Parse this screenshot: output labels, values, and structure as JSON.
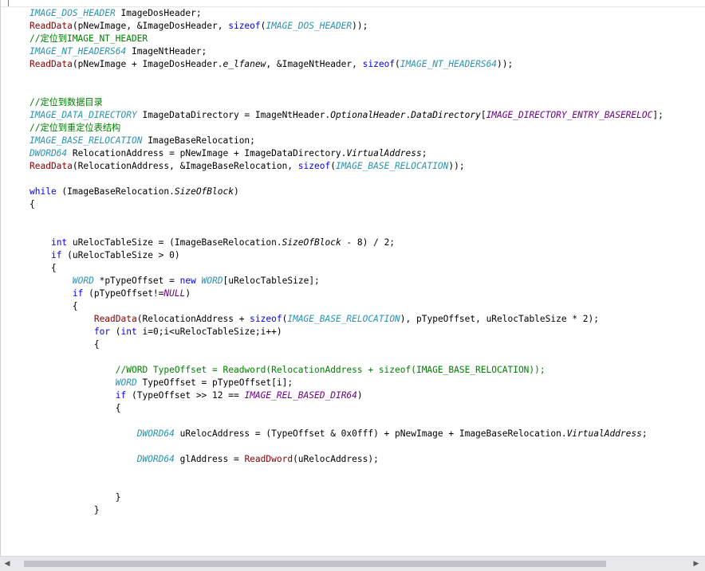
{
  "editor": {
    "lines": [
      {
        "segs": [
          {
            "c": "ty",
            "t": "IMAGE_DOS_HEADER"
          },
          {
            "c": "nm",
            "t": " ImageDosHeader;"
          }
        ]
      },
      {
        "segs": [
          {
            "c": "fn",
            "t": "ReadData"
          },
          {
            "c": "nm",
            "t": "(pNewImage, &ImageDosHeader, "
          },
          {
            "c": "kw",
            "t": "sizeof"
          },
          {
            "c": "nm",
            "t": "("
          },
          {
            "c": "ty",
            "t": "IMAGE_DOS_HEADER"
          },
          {
            "c": "nm",
            "t": "));"
          }
        ]
      },
      {
        "segs": [
          {
            "c": "cm",
            "t": "//定位到IMAGE_NT_HEADER"
          }
        ]
      },
      {
        "segs": [
          {
            "c": "ty",
            "t": "IMAGE_NT_HEADERS64"
          },
          {
            "c": "nm",
            "t": " ImageNtHeader;"
          }
        ]
      },
      {
        "segs": [
          {
            "c": "fn",
            "t": "ReadData"
          },
          {
            "c": "nm",
            "t": "(pNewImage + ImageDosHeader."
          },
          {
            "c": "mem",
            "t": "e_lfanew"
          },
          {
            "c": "nm",
            "t": ", &ImageNtHeader, "
          },
          {
            "c": "kw",
            "t": "sizeof"
          },
          {
            "c": "nm",
            "t": "("
          },
          {
            "c": "ty",
            "t": "IMAGE_NT_HEADERS64"
          },
          {
            "c": "nm",
            "t": "));"
          }
        ]
      },
      {
        "segs": []
      },
      {
        "segs": []
      },
      {
        "segs": [
          {
            "c": "cm",
            "t": "//定位到数据目录"
          }
        ]
      },
      {
        "segs": [
          {
            "c": "ty",
            "t": "IMAGE_DATA_DIRECTORY"
          },
          {
            "c": "nm",
            "t": " ImageDataDirectory = ImageNtHeader."
          },
          {
            "c": "mem",
            "t": "OptionalHeader"
          },
          {
            "c": "nm",
            "t": "."
          },
          {
            "c": "mem",
            "t": "DataDirectory"
          },
          {
            "c": "nm",
            "t": "["
          },
          {
            "c": "mac",
            "t": "IMAGE_DIRECTORY_ENTRY_BASERELOC"
          },
          {
            "c": "nm",
            "t": "];"
          }
        ]
      },
      {
        "segs": [
          {
            "c": "cm",
            "t": "//定位到重定位表结构"
          }
        ]
      },
      {
        "segs": [
          {
            "c": "ty",
            "t": "IMAGE_BASE_RELOCATION"
          },
          {
            "c": "nm",
            "t": " ImageBaseRelocation;"
          }
        ]
      },
      {
        "segs": [
          {
            "c": "ty",
            "t": "DWORD64"
          },
          {
            "c": "nm",
            "t": " RelocationAddress = pNewImage + ImageDataDirectory."
          },
          {
            "c": "mem",
            "t": "VirtualAddress"
          },
          {
            "c": "nm",
            "t": ";"
          }
        ]
      },
      {
        "segs": [
          {
            "c": "fn",
            "t": "ReadData"
          },
          {
            "c": "nm",
            "t": "(RelocationAddress, &ImageBaseRelocation, "
          },
          {
            "c": "kw",
            "t": "sizeof"
          },
          {
            "c": "nm",
            "t": "("
          },
          {
            "c": "ty",
            "t": "IMAGE_BASE_RELOCATION"
          },
          {
            "c": "nm",
            "t": "));"
          }
        ]
      },
      {
        "segs": []
      },
      {
        "segs": [
          {
            "c": "kw",
            "t": "while"
          },
          {
            "c": "nm",
            "t": " (ImageBaseRelocation."
          },
          {
            "c": "mem",
            "t": "SizeOfBlock"
          },
          {
            "c": "nm",
            "t": ")"
          }
        ]
      },
      {
        "segs": [
          {
            "c": "nm",
            "t": "{"
          }
        ]
      },
      {
        "segs": []
      },
      {
        "segs": []
      },
      {
        "segs": [
          {
            "c": "nm",
            "t": "    "
          },
          {
            "c": "kw",
            "t": "int"
          },
          {
            "c": "nm",
            "t": " uRelocTableSize = (ImageBaseRelocation."
          },
          {
            "c": "mem",
            "t": "SizeOfBlock"
          },
          {
            "c": "nm",
            "t": " - 8) / 2;"
          }
        ]
      },
      {
        "segs": [
          {
            "c": "nm",
            "t": "    "
          },
          {
            "c": "kw",
            "t": "if"
          },
          {
            "c": "nm",
            "t": " (uRelocTableSize > 0)"
          }
        ]
      },
      {
        "segs": [
          {
            "c": "nm",
            "t": "    {"
          }
        ]
      },
      {
        "segs": [
          {
            "c": "nm",
            "t": "        "
          },
          {
            "c": "ty",
            "t": "WORD"
          },
          {
            "c": "nm",
            "t": " *pTypeOffset = "
          },
          {
            "c": "kw",
            "t": "new"
          },
          {
            "c": "nm",
            "t": " "
          },
          {
            "c": "ty",
            "t": "WORD"
          },
          {
            "c": "nm",
            "t": "[uRelocTableSize];"
          }
        ]
      },
      {
        "segs": [
          {
            "c": "nm",
            "t": "        "
          },
          {
            "c": "kw",
            "t": "if"
          },
          {
            "c": "nm",
            "t": " (pTypeOffset!="
          },
          {
            "c": "mac",
            "t": "NULL"
          },
          {
            "c": "nm",
            "t": ")"
          }
        ]
      },
      {
        "segs": [
          {
            "c": "nm",
            "t": "        {"
          }
        ]
      },
      {
        "segs": [
          {
            "c": "nm",
            "t": "            "
          },
          {
            "c": "fn",
            "t": "ReadData"
          },
          {
            "c": "nm",
            "t": "(RelocationAddress + "
          },
          {
            "c": "kw",
            "t": "sizeof"
          },
          {
            "c": "nm",
            "t": "("
          },
          {
            "c": "ty",
            "t": "IMAGE_BASE_RELOCATION"
          },
          {
            "c": "nm",
            "t": "), pTypeOffset, uRelocTableSize * 2);"
          }
        ]
      },
      {
        "segs": [
          {
            "c": "nm",
            "t": "            "
          },
          {
            "c": "kw",
            "t": "for"
          },
          {
            "c": "nm",
            "t": " ("
          },
          {
            "c": "kw",
            "t": "int"
          },
          {
            "c": "nm",
            "t": " i=0;i<uRelocTableSize;i++)"
          }
        ]
      },
      {
        "segs": [
          {
            "c": "nm",
            "t": "            {"
          }
        ]
      },
      {
        "segs": []
      },
      {
        "segs": [
          {
            "c": "nm",
            "t": "                "
          },
          {
            "c": "cm",
            "t": "//WORD TypeOffset = Readword(RelocationAddress + sizeof(IMAGE_BASE_RELOCATION));"
          }
        ]
      },
      {
        "segs": [
          {
            "c": "nm",
            "t": "                "
          },
          {
            "c": "ty",
            "t": "WORD"
          },
          {
            "c": "nm",
            "t": " TypeOffset = pTypeOffset[i];"
          }
        ]
      },
      {
        "segs": [
          {
            "c": "nm",
            "t": "                "
          },
          {
            "c": "kw",
            "t": "if"
          },
          {
            "c": "nm",
            "t": " (TypeOffset >> 12 == "
          },
          {
            "c": "mac",
            "t": "IMAGE_REL_BASED_DIR64"
          },
          {
            "c": "nm",
            "t": ")"
          }
        ]
      },
      {
        "segs": [
          {
            "c": "nm",
            "t": "                {"
          }
        ]
      },
      {
        "segs": []
      },
      {
        "segs": [
          {
            "c": "nm",
            "t": "                    "
          },
          {
            "c": "ty",
            "t": "DWORD64"
          },
          {
            "c": "nm",
            "t": " uRelocAddress = (TypeOffset & 0x0fff) + pNewImage + ImageBaseRelocation."
          },
          {
            "c": "mem",
            "t": "VirtualAddress"
          },
          {
            "c": "nm",
            "t": ";"
          }
        ]
      },
      {
        "segs": []
      },
      {
        "segs": [
          {
            "c": "nm",
            "t": "                    "
          },
          {
            "c": "ty",
            "t": "DWORD64"
          },
          {
            "c": "nm",
            "t": " glAddress = "
          },
          {
            "c": "fn",
            "t": "ReadDword"
          },
          {
            "c": "nm",
            "t": "(uRelocAddress);"
          }
        ]
      },
      {
        "segs": []
      },
      {
        "segs": []
      },
      {
        "segs": [
          {
            "c": "nm",
            "t": "                }"
          }
        ]
      },
      {
        "segs": [
          {
            "c": "nm",
            "t": "            }"
          }
        ]
      }
    ]
  },
  "scrollbar": {
    "left_arrow": "◀",
    "right_arrow": "▶"
  },
  "colors": {
    "keyword": "#0000ff",
    "type": "#2b91af",
    "function": "#880000",
    "comment": "#008000",
    "macro": "#6f008a"
  }
}
